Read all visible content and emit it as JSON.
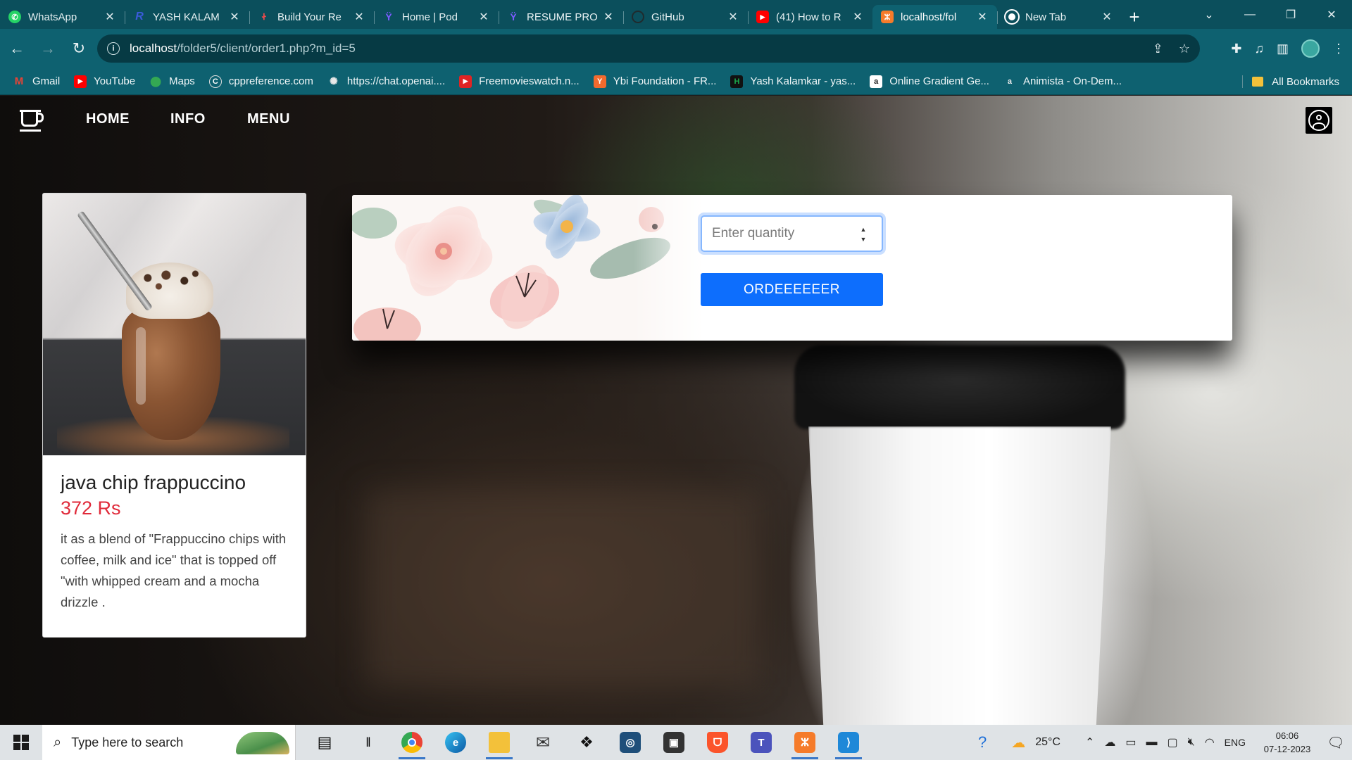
{
  "browser": {
    "tabs": [
      {
        "title": "WhatsApp",
        "icon": "whatsapp-icon",
        "color": "#25d366",
        "glyph": "✆",
        "active": false
      },
      {
        "title": "YASH KALAM",
        "icon": "resume-r-icon",
        "color": "#3b5bdb",
        "glyph": "R",
        "active": false
      },
      {
        "title": "Build Your Re",
        "icon": "resume-builder-icon",
        "color": "#d9313b",
        "glyph": "Ꮠ",
        "active": false
      },
      {
        "title": "Home | Pod",
        "icon": "pod-icon",
        "color": "#5a3fd6",
        "glyph": "Ϋ",
        "active": false
      },
      {
        "title": "RESUME PRO",
        "icon": "pod-icon",
        "color": "#5a3fd6",
        "glyph": "Ϋ",
        "active": false
      },
      {
        "title": "GitHub",
        "icon": "github-icon",
        "color": "#111111",
        "glyph": "◯",
        "active": false
      },
      {
        "title": "(41) How to R",
        "icon": "youtube-icon",
        "color": "#ff0000",
        "glyph": "▶",
        "active": false
      },
      {
        "title": "localhost/fol",
        "icon": "xampp-icon",
        "color": "#f57b2a",
        "glyph": "ⵣ",
        "active": true
      },
      {
        "title": "New Tab",
        "icon": "chrome-icon",
        "color": "#ffffff",
        "glyph": "◉",
        "active": false
      }
    ],
    "close_glyph": "✕",
    "new_tab_glyph": "+",
    "window_controls": {
      "dropdown": "⌄",
      "minimize": "—",
      "restore": "❐",
      "close": "✕"
    },
    "url_host": "localhost",
    "url_path": "/folder5/client/order1.php?m_id=5",
    "bookmarks": [
      {
        "label": "Gmail",
        "icon": "gmail-icon",
        "color": "#ea4335",
        "glyph": "M"
      },
      {
        "label": "YouTube",
        "icon": "youtube-icon",
        "color": "#ff0000",
        "glyph": "▶"
      },
      {
        "label": "Maps",
        "icon": "maps-icon",
        "color": "#34a853",
        "glyph": "⬤"
      },
      {
        "label": "cppreference.com",
        "icon": "cppreference-icon",
        "color": "#555555",
        "glyph": "C"
      },
      {
        "label": "https://chat.openai....",
        "icon": "openai-icon",
        "color": "#10a37f",
        "glyph": "✺"
      },
      {
        "label": "Freemovieswatch.n...",
        "icon": "movies-icon",
        "color": "#e02424",
        "glyph": "▶"
      },
      {
        "label": "Ybi Foundation - FR...",
        "icon": "ybi-icon",
        "color": "#f26a2e",
        "glyph": "Y"
      },
      {
        "label": "Yash Kalamkar - yas...",
        "icon": "hackerrank-icon",
        "color": "#1ba94c",
        "glyph": "H"
      },
      {
        "label": "Online Gradient Ge...",
        "icon": "gradient-icon",
        "color": "#1a1a1a",
        "glyph": "a"
      },
      {
        "label": "Animista - On-Dem...",
        "icon": "animista-icon",
        "color": "#333333",
        "glyph": "a"
      }
    ],
    "all_bookmarks_label": "All Bookmarks"
  },
  "site": {
    "nav": [
      "HOME",
      "INFO",
      "MENU"
    ],
    "product": {
      "name": "java chip frappuccino",
      "price": "372 Rs",
      "description": "it as a blend of \"Frappuccino chips with coffee, milk and ice\" that is topped off \"with whipped cream and a mocha drizzle ."
    },
    "order": {
      "quantity_placeholder": "Enter quantity",
      "quantity_value": "",
      "button_label": "ORDEEEEEER"
    },
    "colors": {
      "price": "#e02a3a",
      "button": "#0d6efd"
    }
  },
  "taskbar": {
    "search_placeholder": "Type here to search",
    "weather": "25°C",
    "language": "ENG",
    "time": "06:06",
    "date": "07-12-2023"
  }
}
